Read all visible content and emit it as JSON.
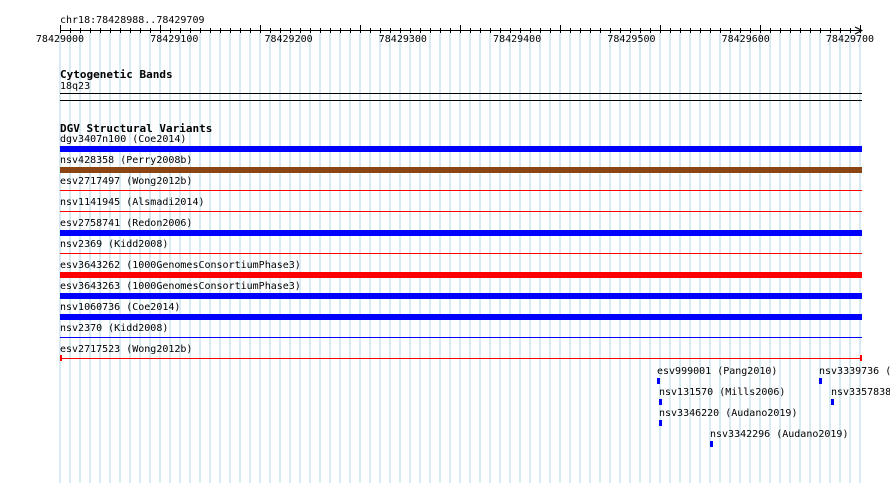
{
  "ruler": {
    "location": "chr18:78428988..78429709",
    "start": 78429000,
    "end": 78429700,
    "ticks": [
      "78429000",
      "78429100",
      "78429200",
      "78429300",
      "78429400",
      "78429500",
      "78429600",
      "78429700"
    ]
  },
  "tracks": {
    "cytobands": {
      "title": "Cytogenetic Bands",
      "band": "18q23"
    },
    "dgv": {
      "title": "DGV Structural Variants",
      "rows": [
        {
          "label": "dgv3407n100 (Coe2014)",
          "color": "#0000ff",
          "style": "thick"
        },
        {
          "label": "nsv428358 (Perry2008b)",
          "color": "#8b4513",
          "style": "thick"
        },
        {
          "label": "esv2717497 (Wong2012b)",
          "color": "#ff0000",
          "style": "thin"
        },
        {
          "label": "nsv1141945 (Alsmadi2014)",
          "color": "#ff0000",
          "style": "thin"
        },
        {
          "label": "esv2758741 (Redon2006)",
          "color": "#0000ff",
          "style": "thick"
        },
        {
          "label": "nsv2369 (Kidd2008)",
          "color": "#ff0000",
          "style": "thin"
        },
        {
          "label": "esv3643262 (1000GenomesConsortiumPhase3)",
          "color": "#ff0000",
          "style": "thick"
        },
        {
          "label": "esv3643263 (1000GenomesConsortiumPhase3)",
          "color": "#0000ff",
          "style": "thick"
        },
        {
          "label": "nsv1060736 (Coe2014)",
          "color": "#0000ff",
          "style": "thick"
        },
        {
          "label": "nsv2370 (Kidd2008)",
          "color": "#0000ff",
          "style": "thin"
        },
        {
          "label": "esv2717523 (Wong2012b)",
          "color": "#ff0000",
          "style": "thin-capped"
        }
      ],
      "small_features": [
        {
          "label": "esv999001 (Pang2010)",
          "color": "#0000ff"
        },
        {
          "label": "nsv3339736 (",
          "color": "#0000ff"
        },
        {
          "label": "nsv131570 (Mills2006)",
          "color": "#0000ff"
        },
        {
          "label": "nsv3357838",
          "color": "#0000ff"
        },
        {
          "label": "nsv3346220 (Audano2019)",
          "color": "#0000ff"
        },
        {
          "label": "nsv3342296 (Audano2019)",
          "color": "#0000ff"
        }
      ]
    }
  },
  "colors": {
    "grid": "#add8e6",
    "blue": "#0000ff",
    "red": "#ff0000",
    "brown": "#8b4513"
  }
}
